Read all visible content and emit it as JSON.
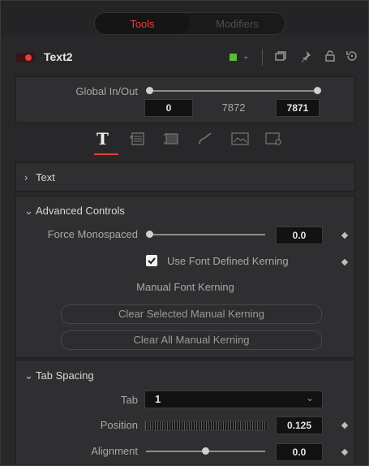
{
  "tabs": {
    "tools": "Tools",
    "modifiers": "Modifiers"
  },
  "node": {
    "name": "Text2",
    "color": "#5fb83a"
  },
  "global": {
    "label": "Global In/Out",
    "start": "0",
    "duration": "7872",
    "end": "7871"
  },
  "inspector_tabs": [
    {
      "name": "text",
      "glyph": "T"
    },
    {
      "name": "layout",
      "glyph": "▤"
    },
    {
      "name": "transform",
      "glyph": "⬚"
    },
    {
      "name": "shading",
      "glyph": "✎"
    },
    {
      "name": "image",
      "glyph": "▣"
    },
    {
      "name": "settings",
      "glyph": "⚙"
    }
  ],
  "sections": {
    "text": "Text",
    "advanced": "Advanced Controls",
    "tab_spacing": "Tab Spacing"
  },
  "advanced": {
    "force_monospaced_label": "Force Monospaced",
    "force_monospaced_value": "0.0",
    "use_font_kerning_label": "Use Font Defined Kerning",
    "use_font_kerning_checked": true,
    "manual_kerning_label": "Manual Font Kerning",
    "clear_selected": "Clear Selected Manual Kerning",
    "clear_all": "Clear All Manual Kerning"
  },
  "tab_spacing": {
    "tab_label": "Tab",
    "tab_value": "1",
    "position_label": "Position",
    "position_value": "0.125",
    "alignment_label": "Alignment",
    "alignment_value": "0.0"
  },
  "colors": {
    "accent": "#e0403b",
    "panel": "#2f2f31",
    "background": "#28282a"
  }
}
